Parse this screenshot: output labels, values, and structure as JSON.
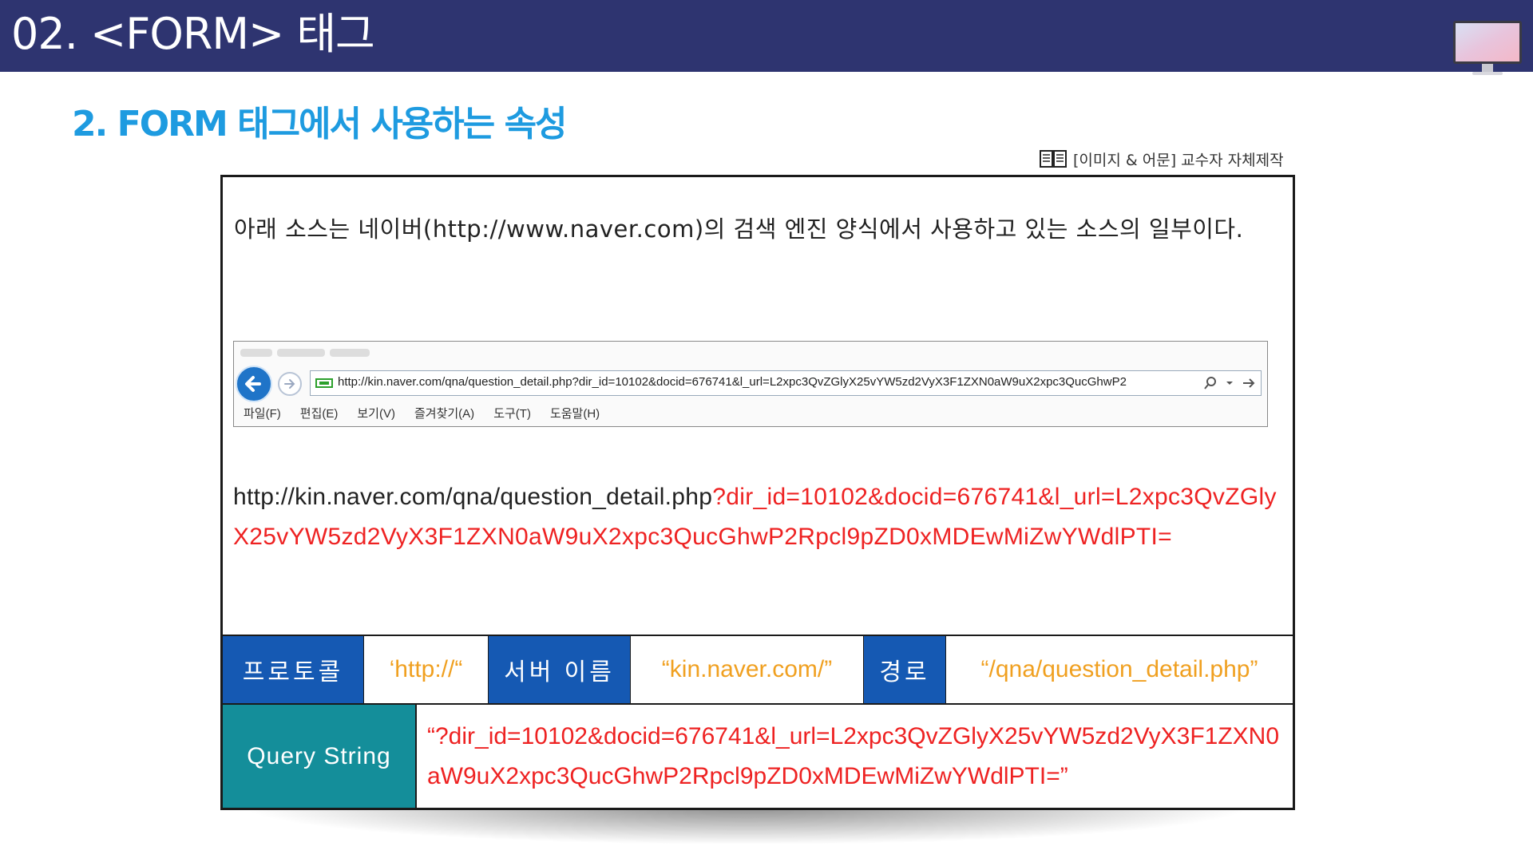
{
  "header": {
    "title": "02. <FORM> 태그"
  },
  "section": {
    "title": "2. FORM 태그에서 사용하는 속성"
  },
  "source_note": "[이미지 & 어문] 교수자 자체제작",
  "intro": "아래 소스는 네이버(http://www.naver.com)의 검색 엔진 양식에서 사용하고 있는 소스의 일부이다.",
  "browser": {
    "address": "http://kin.naver.com/qna/question_detail.php?dir_id=10102&docid=676741&l_url=L2xpc3QvZGlyX25vYW5zd2VyX3F1ZXN0aW9uX2xpc3QucGhwP2",
    "menu": [
      "파일(F)",
      "편집(E)",
      "보기(V)",
      "즐겨찾기(A)",
      "도구(T)",
      "도움말(H)"
    ]
  },
  "url": {
    "base": "http://kin.naver.com/qna/question_detail.php",
    "query": "?dir_id=10102&docid=676741&l_url=L2xpc3QvZGlyX25vYW5zd2VyX3F1ZXN0aW9uX2xpc3QucGhwP2Rpcl9pZD0xMDEwMiZwYWdlPTI="
  },
  "table": {
    "protocol_label": "프로토콜",
    "protocol_value": "‘http://“",
    "server_label": "서버 이름",
    "server_value": "“kin.naver.com/”",
    "path_label": "경로",
    "path_value": "“/qna/question_detail.php”",
    "query_label": "Query String",
    "query_value": "“?dir_id=10102&docid=676741&l_url=L2xpc3QvZGlyX25vYW5zd2VyX3F1ZXN0aW9uX2xpc3QucGhwP2Rpcl9pZD0xMDEwMiZwYWdlPTI=”"
  },
  "colors": {
    "header_bg": "#2e3470",
    "section_title": "#1e9be0",
    "highlight_red": "#ee2222",
    "cell_blue": "#1559b3",
    "cell_teal": "#148e9a",
    "value_orange": "#f0a020"
  },
  "icons": [
    "monitor-icon",
    "book-icon",
    "back-arrow-icon",
    "forward-arrow-icon",
    "search-icon"
  ]
}
